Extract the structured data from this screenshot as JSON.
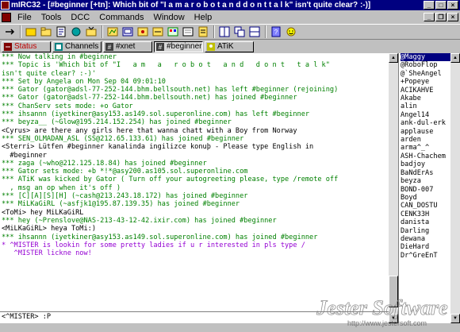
{
  "window": {
    "title": "mIRC32 - [#beginner [+tn]: Which bit of \"I  a m  a  r o b o t  a n d  d o n t  t a l k\" isn't quite clear? :-)]"
  },
  "menu": {
    "items": [
      "File",
      "Tools",
      "DCC",
      "Commands",
      "Window",
      "Help"
    ]
  },
  "toolbar": {
    "icons": [
      "connect-icon",
      "options-icon",
      "channels-folder-icon",
      "url-icon",
      "notify-icon",
      "send-icon",
      "chat-icon",
      "finger-icon",
      "log-icon",
      "timer-icon",
      "colors-icon",
      "address-icon",
      "script-icon",
      "tile-icon",
      "cascade-icon",
      "arrange-icon",
      "help-icon",
      "about-icon"
    ]
  },
  "switchbar": {
    "tabs": [
      {
        "label": "Status",
        "name": "tab-status"
      },
      {
        "label": "Channels",
        "name": "tab-channels"
      },
      {
        "label": "#xnet",
        "name": "tab-xnet"
      },
      {
        "label": "#beginner",
        "name": "tab-beginner"
      },
      {
        "label": "ATiK",
        "name": "tab-atik"
      }
    ]
  },
  "chat": {
    "lines": [
      {
        "text": "",
        "color": "green"
      },
      {
        "text": "",
        "color": "green"
      },
      {
        "text": "",
        "color": "green"
      },
      {
        "text": "*** Now talking in #beginner",
        "color": "green"
      },
      {
        "text": "*** Topic is 'Which bit of \"I   a m   a   r o b o t   a n d   d o n t   t a l k\"",
        "color": "green"
      },
      {
        "text": "isn't quite clear? :-)'",
        "color": "green"
      },
      {
        "text": "*** Set by Angela on Mon Sep 04 09:01:10",
        "color": "green"
      },
      {
        "text": "*** Gator (gator@adsl-77-252-144.bhm.bellsouth.net) has left #beginner (rejoining)",
        "color": "green"
      },
      {
        "text": "*** Gator (gator@adsl-77-252-144.bhm.bellsouth.net) has joined #beginner",
        "color": "green"
      },
      {
        "text": "*** ChanServ sets mode: +o Gator",
        "color": "green"
      },
      {
        "text": "*** ihsannn (iyetkiner@asy153.as149.sol.superonline.com) has left #beginner",
        "color": "green"
      },
      {
        "text": "*** beyza__ (~Glow@195.214.152.254) has joined #beginner",
        "color": "green"
      },
      {
        "text": "<Cyrus> are there any girls here that wanna chatt with a Boy from Norway",
        "color": "black"
      },
      {
        "text": "*** SEN_OLMADAN_ASL (SS@212.65.133.61) has joined #beginner",
        "color": "green"
      },
      {
        "text": "<Sterri> Lütfen #beginner kanalinda ingilizce konuþ - Please type English in",
        "color": "black"
      },
      {
        "text": "  #beginner",
        "color": "black"
      },
      {
        "text": "*** zaga (~who@212.125.18.84) has joined #beginner",
        "color": "green"
      },
      {
        "text": "*** Gator sets mode: +b *!*@asy200.as105.sol.superonline.com",
        "color": "green"
      },
      {
        "text": "*** ATiK was kicked by Gator ( Turn off your autogreeting please, type /remote off",
        "color": "green"
      },
      {
        "text": "  , msg an op when it's off )",
        "color": "green"
      },
      {
        "text": "*** [C][A][S][H] (~cash@213.243.18.172) has joined #beginner",
        "color": "green"
      },
      {
        "text": "*** MiLKaGiRL (~asfjk1@195.87.139.35) has joined #beginner",
        "color": "green"
      },
      {
        "text": "<ToMi> hey MiLKaGiRL",
        "color": "black"
      },
      {
        "text": "*** hey (~Prenslove@NAS-213-43-12-42.ixir.com) has joined #beginner",
        "color": "green"
      },
      {
        "text": "<MiLKaGiRL> heya ToMi:)",
        "color": "black"
      },
      {
        "text": "*** ihsannn (iyetkiner@asy153.as149.sol.superonline.com) has joined #beginner",
        "color": "green"
      },
      {
        "text": "* ^MISTER is lookin for some pretty ladies if u r interested in pls type /",
        "color": "purple"
      },
      {
        "text": "   ^MISTER lickne now!",
        "color": "purple"
      }
    ],
    "input": "<^MISTER> :P"
  },
  "nicklist": {
    "nicks": [
      "@Maggy",
      "@RoboFlop",
      "@`SheAngel",
      "+Popeye",
      "ACIKAHVE",
      "Akabe",
      "alin",
      "Angel14",
      "ank-dul-erk",
      "applause",
      "arden",
      "arma^_^",
      "ASH-Chachem",
      "badjoy",
      "BaNdErAs",
      "beyza",
      "BOND-007",
      "Boyd",
      "CAN_DOSTU",
      "CENK33H",
      "danista",
      "Darling",
      "dewana",
      "DieHard",
      "Dr^GreEnT"
    ],
    "selected_index": 0
  },
  "watermark": {
    "brand": "Jester Software",
    "url": "http://www.jestersoft.com"
  },
  "colors": {
    "titlebar": "#000080",
    "system_message": "#008000",
    "action": "#9400d3",
    "face": "#c0c0c0"
  }
}
